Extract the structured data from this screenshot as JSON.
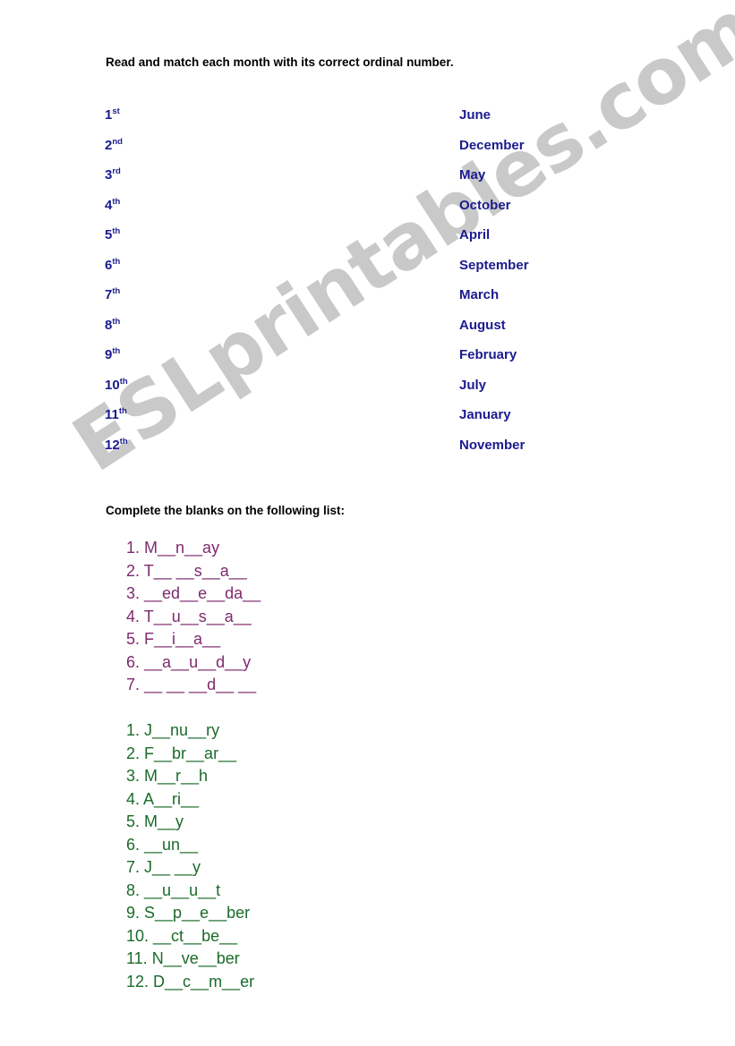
{
  "watermark": {
    "text": "ESLprintables.com",
    "color": "#c9c9c9"
  },
  "colors": {
    "blue": "#1b1b8f",
    "purple": "#7d2a6e",
    "green": "#1a6b2a",
    "black": "#000000"
  },
  "instructions": {
    "matching": "Read and match each month with its correct ordinal number.",
    "blanks": "Complete the blanks on the following list:"
  },
  "matching": {
    "ordinals": [
      {
        "number": "1",
        "suffix": "st"
      },
      {
        "number": "2",
        "suffix": "nd"
      },
      {
        "number": "3",
        "suffix": "rd"
      },
      {
        "number": "4",
        "suffix": "th"
      },
      {
        "number": "5",
        "suffix": "th"
      },
      {
        "number": "6",
        "suffix": "th"
      },
      {
        "number": "7",
        "suffix": "th"
      },
      {
        "number": "8",
        "suffix": "th"
      },
      {
        "number": "9",
        "suffix": "th"
      },
      {
        "number": "10",
        "suffix": "th"
      },
      {
        "number": "11",
        "suffix": "th"
      },
      {
        "number": "12",
        "suffix": "th"
      }
    ],
    "months": [
      "June",
      "December",
      "May",
      "October",
      "April",
      "September",
      "March",
      "August",
      "February",
      "July",
      "January",
      "November"
    ]
  },
  "weekday_blanks": [
    "1. M__n__ay",
    "2. T__ __s__a__",
    "3. __ed__e__da__",
    "4. T__u__s__a__",
    "5. F__i__a__",
    "6. __a__u__d__y",
    "7. __ __ __d__ __"
  ],
  "month_blanks": [
    "1. J__nu__ry",
    "2. F__br__ar__",
    "3. M__r__h",
    "4. A__ri__",
    "5. M__y",
    "6. __un__",
    "7. J__ __y",
    "8. __u__u__t",
    "9. S__p__e__ber",
    "10. __ct__be__",
    "11. N__ve__ber",
    "12. D__c__m__er"
  ]
}
